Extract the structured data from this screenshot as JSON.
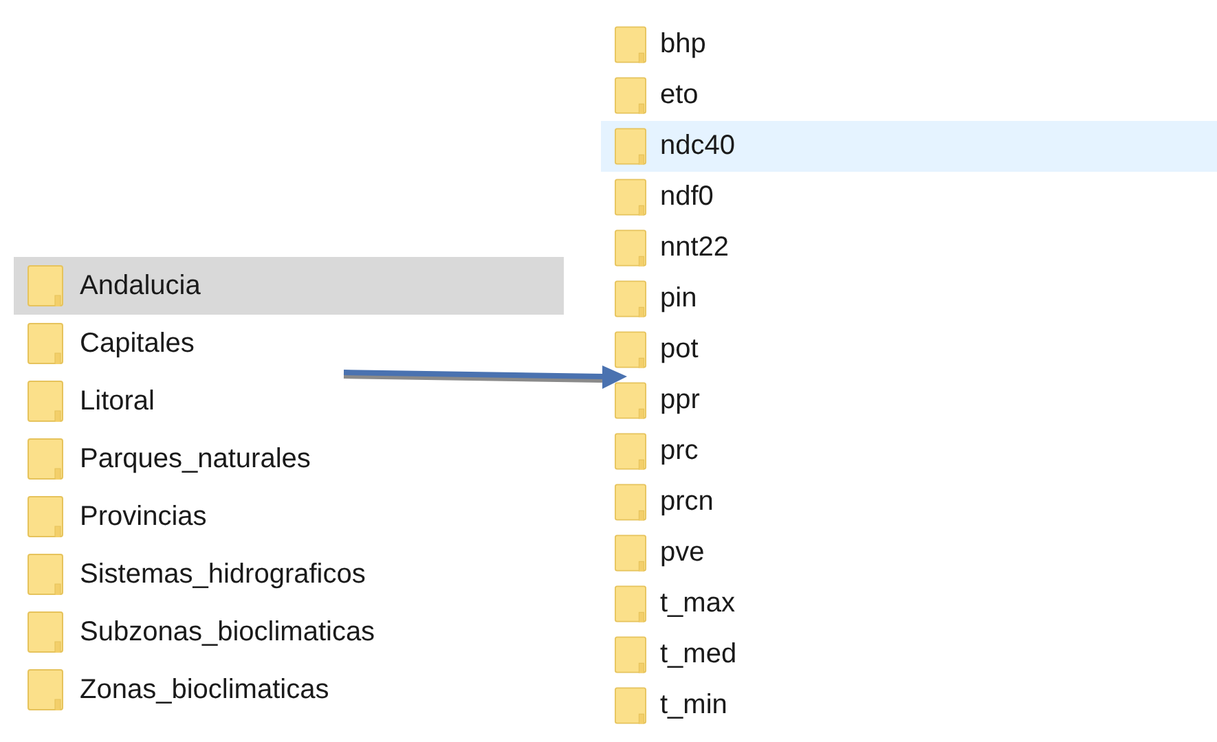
{
  "left_folders": [
    {
      "name": "Andalucia",
      "selected": true
    },
    {
      "name": "Capitales",
      "selected": false
    },
    {
      "name": "Litoral",
      "selected": false
    },
    {
      "name": "Parques_naturales",
      "selected": false
    },
    {
      "name": "Provincias",
      "selected": false
    },
    {
      "name": "Sistemas_hidrograficos",
      "selected": false
    },
    {
      "name": "Subzonas_bioclimaticas",
      "selected": false
    },
    {
      "name": "Zonas_bioclimaticas",
      "selected": false
    }
  ],
  "right_folders": [
    {
      "name": "bhp",
      "highlighted": false
    },
    {
      "name": "eto",
      "highlighted": false
    },
    {
      "name": "ndc40",
      "highlighted": true
    },
    {
      "name": "ndf0",
      "highlighted": false
    },
    {
      "name": "nnt22",
      "highlighted": false
    },
    {
      "name": "pin",
      "highlighted": false
    },
    {
      "name": "pot",
      "highlighted": false
    },
    {
      "name": "ppr",
      "highlighted": false
    },
    {
      "name": "prc",
      "highlighted": false
    },
    {
      "name": "prcn",
      "highlighted": false
    },
    {
      "name": "pve",
      "highlighted": false
    },
    {
      "name": "t_max",
      "highlighted": false
    },
    {
      "name": "t_med",
      "highlighted": false
    },
    {
      "name": "t_min",
      "highlighted": false
    }
  ]
}
